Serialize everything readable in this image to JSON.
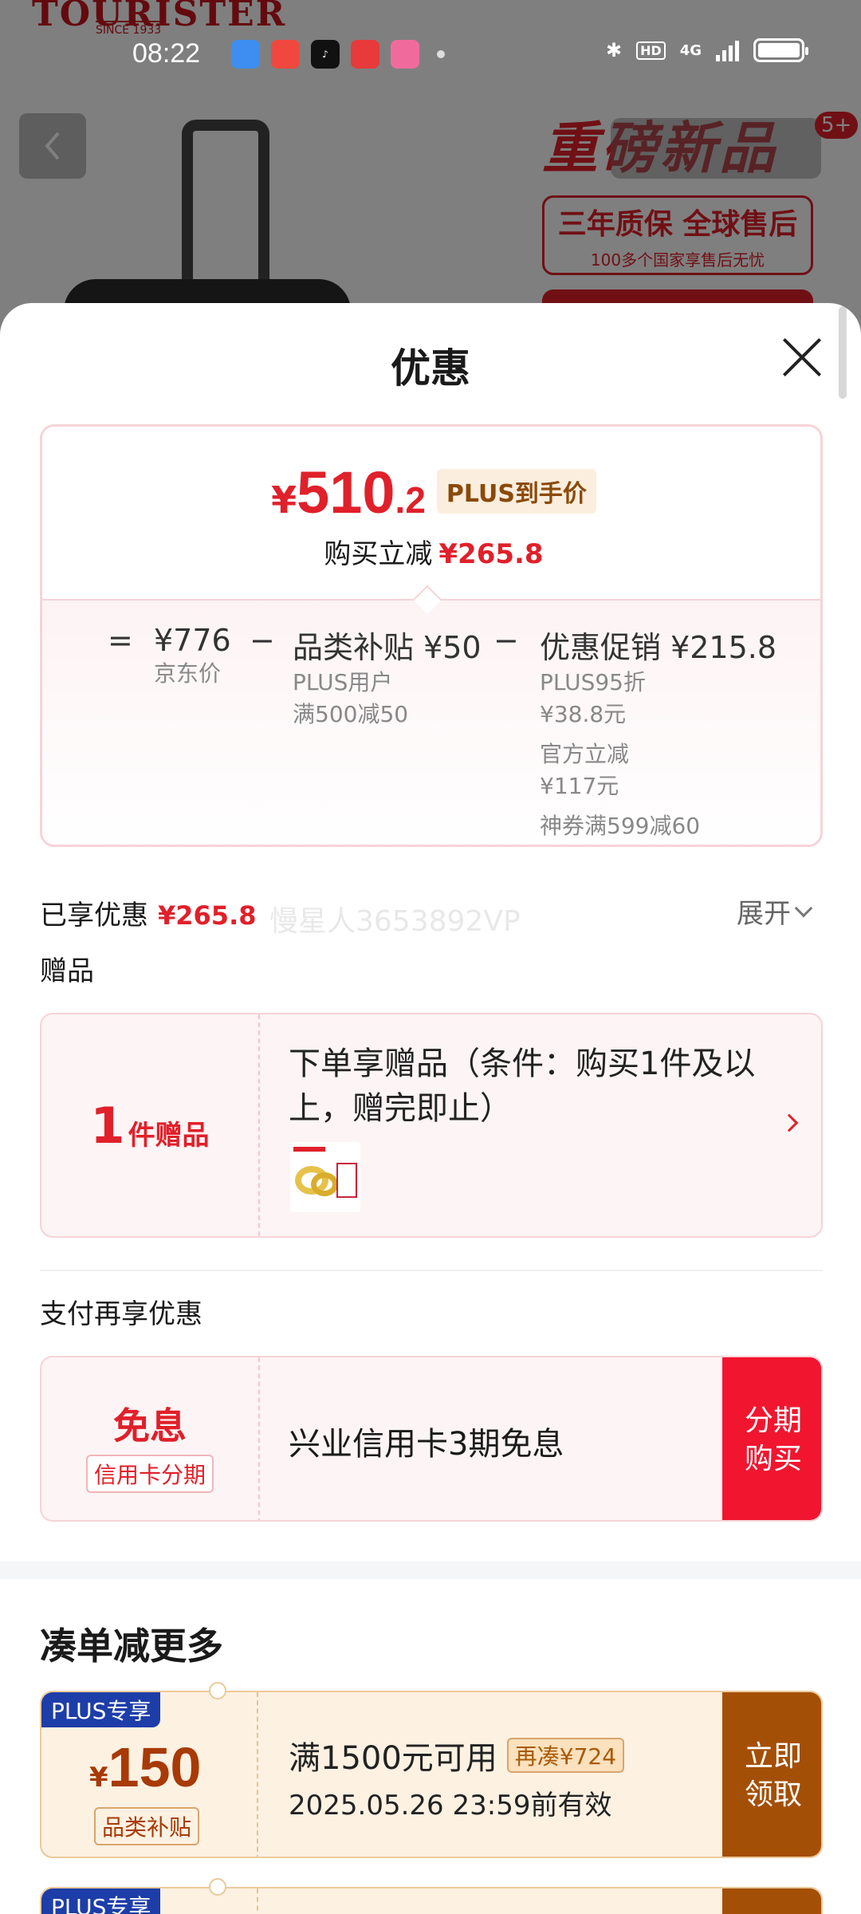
{
  "background": {
    "brand": "TOURISTER",
    "brand_since": "SINCE 1933",
    "promo_big": "重磅新品",
    "promo_line1": "三年质保 全球售后",
    "promo_line2": "100多个国家享售后无忧",
    "badge": "5+"
  },
  "status_bar": {
    "time": "08:22",
    "app_icons": [
      "reader-app",
      "pinduoduo-app",
      "tiktok-app",
      "toutiao-app",
      "bilibili-app"
    ],
    "network": "4G",
    "hd": "HD"
  },
  "sheet": {
    "title": "优惠",
    "price": {
      "yen": "¥",
      "integer": "510",
      "decimal": ".2",
      "tag": "PLUS到手价",
      "reduce_label": "购买立减",
      "reduce_amount": "¥265.8"
    },
    "formula": {
      "eq": "=",
      "minus": "−",
      "jd_price": "¥776",
      "jd_price_label": "京东价",
      "subsidy": "品类补贴 ¥50",
      "subsidy_sub1": "PLUS用户",
      "subsidy_sub2": "满500减50",
      "promo": "优惠促销 ¥215.8",
      "promo_sub": [
        "PLUS95折",
        "¥38.8元",
        "官方立减",
        "¥117元",
        "神券满599减60"
      ]
    },
    "enjoyed": {
      "label": "已享优惠",
      "amount": "¥265.8",
      "expand": "展开"
    },
    "watermark": "慢星人3653892VP",
    "gift": {
      "section_label": "赠品",
      "count": "1",
      "count_unit": "件赠品",
      "text": "下单享赠品（条件：购买1件及以上，赠完即止）"
    },
    "payment": {
      "section_label": "支付再享优惠",
      "free": "免息",
      "cc_tag": "信用卡分期",
      "text": "兴业信用卡3期免息",
      "button": "分期购买"
    },
    "more": {
      "title": "凑单减更多",
      "coupons": [
        {
          "plus_tag": "PLUS专享",
          "yen": "¥",
          "value": "150",
          "category": "品类补贴",
          "condition": "满1500元可用",
          "again": "再凑¥724",
          "expiry": "2025.05.26 23:59前有效",
          "button": "立即领取"
        },
        {
          "plus_tag": "PLUS专享"
        }
      ]
    }
  }
}
